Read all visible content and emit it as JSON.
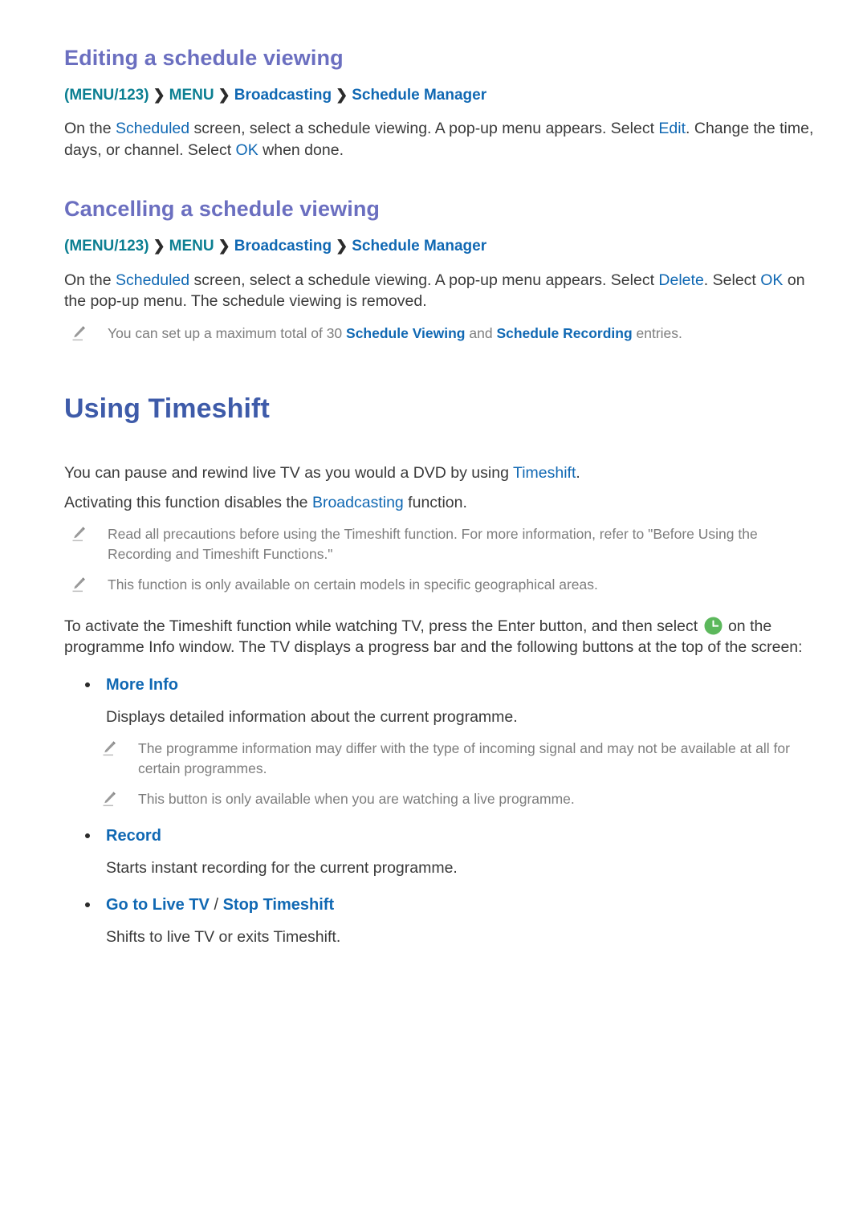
{
  "document": {
    "colors": {
      "section_title": "#6b6fc0",
      "chapter_title": "#3e5ba9",
      "link": "#1068b3",
      "menu_teal": "#0c7f92",
      "body": "#3a3a3a",
      "note": "#7d7d7d",
      "clock_green": "#5cb85c"
    },
    "sections": [
      {
        "id": "editing-a-schedule-viewing",
        "title": "Editing a schedule viewing",
        "breadcrumb": {
          "root": "(MENU/123)",
          "arrow": "❯",
          "items": [
            "MENU",
            "Broadcasting",
            "Schedule Manager"
          ]
        },
        "paragraph_parts": [
          {
            "t": "On the ",
            "k": "p"
          },
          {
            "t": "Scheduled",
            "k": "hl"
          },
          {
            "t": " screen, select a schedule viewing. A pop-up menu appears. Select ",
            "k": "p"
          },
          {
            "t": "Edit",
            "k": "hl"
          },
          {
            "t": ". Change the time, days, or channel. Select ",
            "k": "p"
          },
          {
            "t": "OK",
            "k": "hl"
          },
          {
            "t": " when done.",
            "k": "p"
          }
        ]
      },
      {
        "id": "cancelling-a-schedule-viewing",
        "title": "Cancelling a schedule viewing",
        "breadcrumb": {
          "root": "(MENU/123)",
          "arrow": "❯",
          "items": [
            "MENU",
            "Broadcasting",
            "Schedule Manager"
          ]
        },
        "paragraph_parts": [
          {
            "t": "On the ",
            "k": "p"
          },
          {
            "t": "Scheduled",
            "k": "hl"
          },
          {
            "t": " screen, select a schedule viewing. A pop-up menu appears. Select ",
            "k": "p"
          },
          {
            "t": "Delete",
            "k": "hl"
          },
          {
            "t": ". Select ",
            "k": "p"
          },
          {
            "t": "OK",
            "k": "hl"
          },
          {
            "t": " on the pop-up menu. The schedule viewing is removed.",
            "k": "p"
          }
        ],
        "note_parts": [
          {
            "t": "You can set up a maximum total of 30 ",
            "k": "n"
          },
          {
            "t": "Schedule Viewing",
            "k": "nhl"
          },
          {
            "t": " and ",
            "k": "n"
          },
          {
            "t": "Schedule Recording",
            "k": "nhl"
          },
          {
            "t": " entries.",
            "k": "n"
          }
        ]
      }
    ],
    "chapter": {
      "id": "using-timeshift",
      "title": "Using Timeshift",
      "intro_paragraph_1": [
        {
          "t": "You can pause and rewind live TV as you would a DVD by using ",
          "k": "p"
        },
        {
          "t": "Timeshift",
          "k": "hl"
        },
        {
          "t": ".",
          "k": "p"
        }
      ],
      "intro_paragraph_2": [
        {
          "t": "Activating this function disables the ",
          "k": "p"
        },
        {
          "t": "Broadcasting",
          "k": "hl"
        },
        {
          "t": " function.",
          "k": "p"
        }
      ],
      "notes": [
        "Read all precautions before using the Timeshift function. For more information, refer to \"Before Using the Recording and Timeshift Functions.\"",
        "This function is only available on certain models in specific geographical areas."
      ],
      "activation_paragraph_before": "To activate the Timeshift function while watching TV, press the Enter button, and then select ",
      "activation_icon": "clock-icon",
      "activation_paragraph_after": " on the programme Info window. The TV displays a progress bar and the following buttons at the top of the screen:",
      "buttons": [
        {
          "label": "More Info",
          "label_second": "",
          "separator": "",
          "description": "Displays detailed information about the current programme.",
          "notes": [
            "The programme information may differ with the type of incoming signal and may not be available at all for certain programmes.",
            "This button is only available when you are watching a live programme."
          ]
        },
        {
          "label": "Record",
          "label_second": "",
          "separator": "",
          "description": "Starts instant recording for the current programme.",
          "notes": []
        },
        {
          "label": "Go to Live TV",
          "separator": " / ",
          "label_second": "Stop Timeshift",
          "description": "Shifts to live TV or exits Timeshift.",
          "notes": []
        }
      ]
    }
  }
}
